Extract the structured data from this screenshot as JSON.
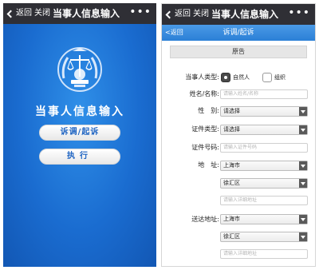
{
  "left_screen": {
    "titlebar": {
      "back_label": "返回",
      "close_label": "关闭",
      "title": "当事人信息输入",
      "more_label": "•••"
    },
    "heading": "当事人信息输入",
    "buttons": {
      "complaint": "诉调/起诉",
      "execute": "执行"
    },
    "emblem_icon": "court-emblem-icon",
    "background_color": "#1a6cd0"
  },
  "right_screen": {
    "titlebar": {
      "back_label": "返回",
      "close_label": "关闭",
      "title": "当事人信息输入",
      "more_label": "•••"
    },
    "subbar": {
      "back_label": "<返回",
      "title": "诉调/起诉"
    },
    "section_title": "原告",
    "party_type": {
      "label": "当事人类型:",
      "options": [
        {
          "label": "自然人",
          "selected": true
        },
        {
          "label": "组织",
          "selected": false
        }
      ]
    },
    "name": {
      "label": "姓名/名称:",
      "placeholder": "请输入姓名/名称"
    },
    "gender": {
      "label": "性　别:",
      "value": "请选择"
    },
    "id_type": {
      "label": "证件类型:",
      "value": "请选择"
    },
    "id_number": {
      "label": "证件号码:",
      "placeholder": "请输入证件号码"
    },
    "address": {
      "label": "地　址:",
      "city": "上海市",
      "district": "徐汇区",
      "detail_placeholder": "请输入详细地址"
    },
    "delivery_address": {
      "label": "送达地址:",
      "city": "上海市",
      "district": "徐汇区",
      "detail_placeholder": "请输入详细地址"
    },
    "accent_color": "#2b7fd6"
  }
}
